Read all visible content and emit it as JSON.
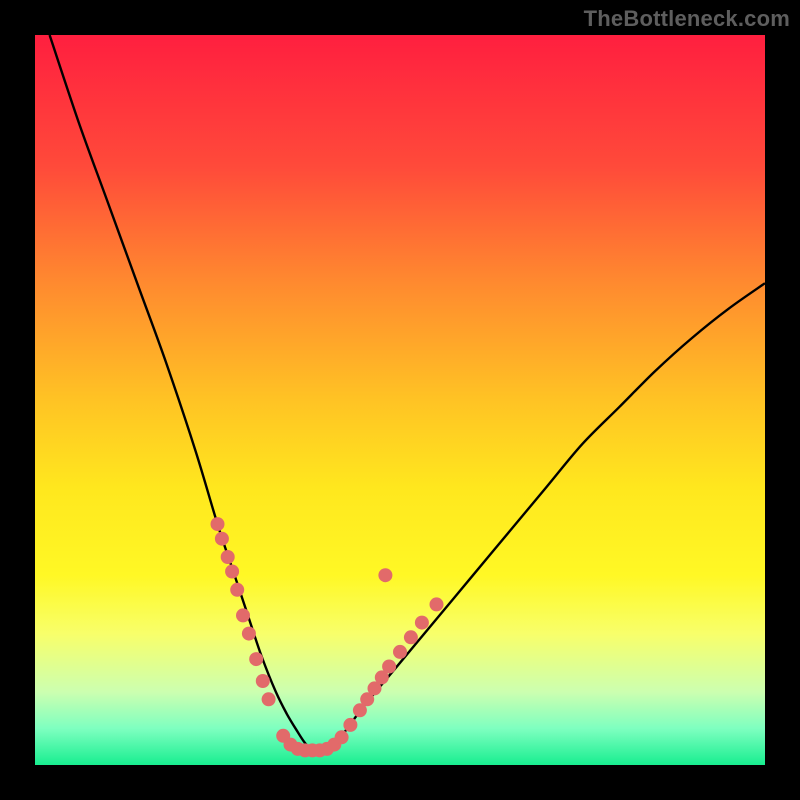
{
  "watermark": "TheBottleneck.com",
  "chart_data": {
    "type": "line",
    "title": "",
    "xlabel": "",
    "ylabel": "",
    "xlim": [
      0,
      100
    ],
    "ylim": [
      0,
      100
    ],
    "series": [
      {
        "name": "bottleneck-curve",
        "x": [
          2,
          6,
          10,
          14,
          18,
          22,
          25,
          27,
          29,
          31,
          33,
          34.5,
          36,
          37,
          38,
          39,
          40,
          42,
          45,
          50,
          55,
          60,
          65,
          70,
          75,
          80,
          85,
          90,
          95,
          100
        ],
        "y": [
          100,
          88,
          77,
          66,
          55,
          43,
          33,
          27,
          21,
          15,
          10,
          7,
          4.5,
          3,
          2,
          2,
          2,
          4,
          8,
          14,
          20,
          26,
          32,
          38,
          44,
          49,
          54,
          58.5,
          62.5,
          66
        ]
      }
    ],
    "markers": {
      "name": "highlight-dots",
      "color": "#e26a6a",
      "points": [
        {
          "x": 25.0,
          "y": 33.0
        },
        {
          "x": 25.6,
          "y": 31.0
        },
        {
          "x": 26.4,
          "y": 28.5
        },
        {
          "x": 27.0,
          "y": 26.5
        },
        {
          "x": 27.7,
          "y": 24.0
        },
        {
          "x": 28.5,
          "y": 20.5
        },
        {
          "x": 29.3,
          "y": 18.0
        },
        {
          "x": 30.3,
          "y": 14.5
        },
        {
          "x": 31.2,
          "y": 11.5
        },
        {
          "x": 32.0,
          "y": 9.0
        },
        {
          "x": 34.0,
          "y": 4.0
        },
        {
          "x": 35.0,
          "y": 2.8
        },
        {
          "x": 36.0,
          "y": 2.2
        },
        {
          "x": 37.0,
          "y": 2.0
        },
        {
          "x": 38.0,
          "y": 2.0
        },
        {
          "x": 39.0,
          "y": 2.0
        },
        {
          "x": 40.0,
          "y": 2.2
        },
        {
          "x": 41.0,
          "y": 2.8
        },
        {
          "x": 42.0,
          "y": 3.8
        },
        {
          "x": 43.2,
          "y": 5.5
        },
        {
          "x": 44.5,
          "y": 7.5
        },
        {
          "x": 45.5,
          "y": 9.0
        },
        {
          "x": 46.5,
          "y": 10.5
        },
        {
          "x": 47.5,
          "y": 12.0
        },
        {
          "x": 48.5,
          "y": 13.5
        },
        {
          "x": 50.0,
          "y": 15.5
        },
        {
          "x": 51.5,
          "y": 17.5
        },
        {
          "x": 53.0,
          "y": 19.5
        },
        {
          "x": 55.0,
          "y": 22.0
        },
        {
          "x": 48.0,
          "y": 26.0
        }
      ]
    }
  }
}
